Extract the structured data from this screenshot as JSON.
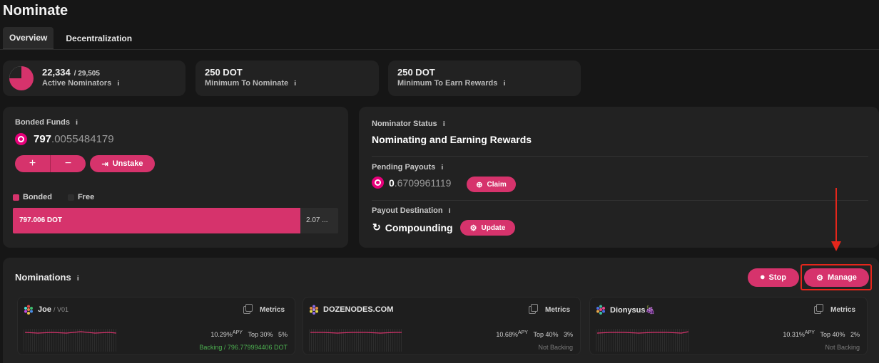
{
  "page": {
    "title": "Nominate"
  },
  "tabs": [
    {
      "label": "Overview",
      "active": true
    },
    {
      "label": "Decentralization",
      "active": false
    }
  ],
  "stats": {
    "active_nominators": {
      "value": "22,334",
      "total": "/ 29,505",
      "label": "Active Nominators",
      "fraction": 0.757
    },
    "minimum_to_nominate": {
      "value": "250 DOT",
      "label": "Minimum To Nominate"
    },
    "minimum_to_earn": {
      "value": "250 DOT",
      "label": "Minimum To Earn Rewards"
    }
  },
  "bonded": {
    "label": "Bonded Funds",
    "amount_int": "797",
    "amount_dec": ".0055484179",
    "plus": "+",
    "minus": "−",
    "unstake_label": "Unstake",
    "legend_bonded": "Bonded",
    "legend_free": "Free",
    "bar_bonded_label": "797.006 DOT",
    "bar_free_label": "2.07 ...",
    "bonded_fraction": 0.9974,
    "colors": {
      "bonded": "#d6336c",
      "free": "#2c2c2c"
    }
  },
  "status": {
    "label": "Nominator Status",
    "value": "Nominating and Earning Rewards",
    "pending_label": "Pending Payouts",
    "pending_int": "0",
    "pending_dec": ".6709961119",
    "claim_label": "Claim",
    "payout_label": "Payout Destination",
    "payout_value": "Compounding",
    "update_label": "Update"
  },
  "nominations": {
    "title": "Nominations",
    "stop_label": "Stop",
    "manage_label": "Manage",
    "validators": [
      {
        "name": "Joe",
        "sub": "/ V01",
        "metrics": "Metrics",
        "apy": "10.29%",
        "apy_unit": "APY",
        "top": "Top 30%",
        "commission": "5%",
        "backing": "Backing / 796.779994406 DOT",
        "backing_color": "#4caf50"
      },
      {
        "name": "DOZENODES.COM",
        "sub": "",
        "metrics": "Metrics",
        "apy": "10.68%",
        "apy_unit": "APY",
        "top": "Top 40%",
        "commission": "3%",
        "backing": "Not Backing",
        "backing_color": "#7a7a7a"
      },
      {
        "name": "Dionysus🍇",
        "sub": "",
        "metrics": "Metrics",
        "apy": "10.31%",
        "apy_unit": "APY",
        "top": "Top 40%",
        "commission": "2%",
        "backing": "Not Backing",
        "backing_color": "#7a7a7a"
      }
    ]
  },
  "accent": "#d6336c",
  "annotation_color": "#e5261b"
}
